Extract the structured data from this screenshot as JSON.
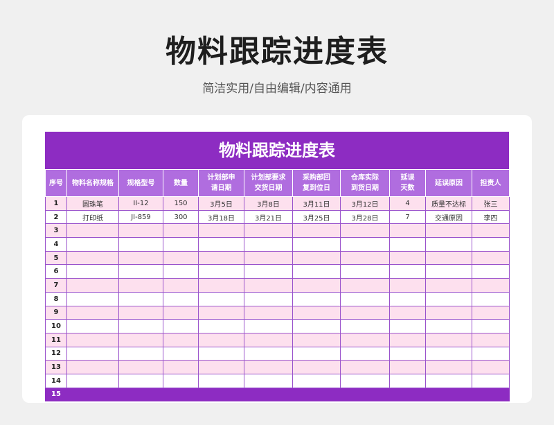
{
  "header": {
    "title": "物料跟踪进度表",
    "subtitle": "简洁实用/自由编辑/内容通用"
  },
  "sheet": {
    "title": "物料跟踪进度表",
    "columns": [
      [
        "序号"
      ],
      [
        "物料名称规格"
      ],
      [
        "规格型号"
      ],
      [
        "数量"
      ],
      [
        "计划部申",
        "请日期"
      ],
      [
        "计划部要求",
        "交货日期"
      ],
      [
        "采购部回",
        "复到位日"
      ],
      [
        "仓库实际",
        "到货日期"
      ],
      [
        "延误",
        "天数"
      ],
      [
        "延误原因"
      ],
      [
        "担责人"
      ]
    ],
    "rows": [
      [
        "1",
        "圆珠笔",
        "II-12",
        "150",
        "3月5日",
        "3月8日",
        "3月11日",
        "3月12日",
        "4",
        "质量不达标",
        "张三"
      ],
      [
        "2",
        "打印纸",
        "JI-859",
        "300",
        "3月18日",
        "3月21日",
        "3月25日",
        "3月28日",
        "7",
        "交通原因",
        "李四"
      ],
      [
        "3",
        "",
        "",
        "",
        "",
        "",
        "",
        "",
        "",
        "",
        ""
      ],
      [
        "4",
        "",
        "",
        "",
        "",
        "",
        "",
        "",
        "",
        "",
        ""
      ],
      [
        "5",
        "",
        "",
        "",
        "",
        "",
        "",
        "",
        "",
        "",
        ""
      ],
      [
        "6",
        "",
        "",
        "",
        "",
        "",
        "",
        "",
        "",
        "",
        ""
      ],
      [
        "7",
        "",
        "",
        "",
        "",
        "",
        "",
        "",
        "",
        "",
        ""
      ],
      [
        "8",
        "",
        "",
        "",
        "",
        "",
        "",
        "",
        "",
        "",
        ""
      ],
      [
        "9",
        "",
        "",
        "",
        "",
        "",
        "",
        "",
        "",
        "",
        ""
      ],
      [
        "10",
        "",
        "",
        "",
        "",
        "",
        "",
        "",
        "",
        "",
        ""
      ],
      [
        "11",
        "",
        "",
        "",
        "",
        "",
        "",
        "",
        "",
        "",
        ""
      ],
      [
        "12",
        "",
        "",
        "",
        "",
        "",
        "",
        "",
        "",
        "",
        ""
      ],
      [
        "13",
        "",
        "",
        "",
        "",
        "",
        "",
        "",
        "",
        "",
        ""
      ],
      [
        "14",
        "",
        "",
        "",
        "",
        "",
        "",
        "",
        "",
        "",
        ""
      ],
      [
        "15",
        "",
        "",
        "",
        "",
        "",
        "",
        "",
        "",
        "",
        ""
      ]
    ]
  },
  "colors": {
    "banner": "#8d2cc2",
    "header_row": "#b06ddf",
    "pink_row": "#fde0ee",
    "border": "#9a52cc"
  }
}
